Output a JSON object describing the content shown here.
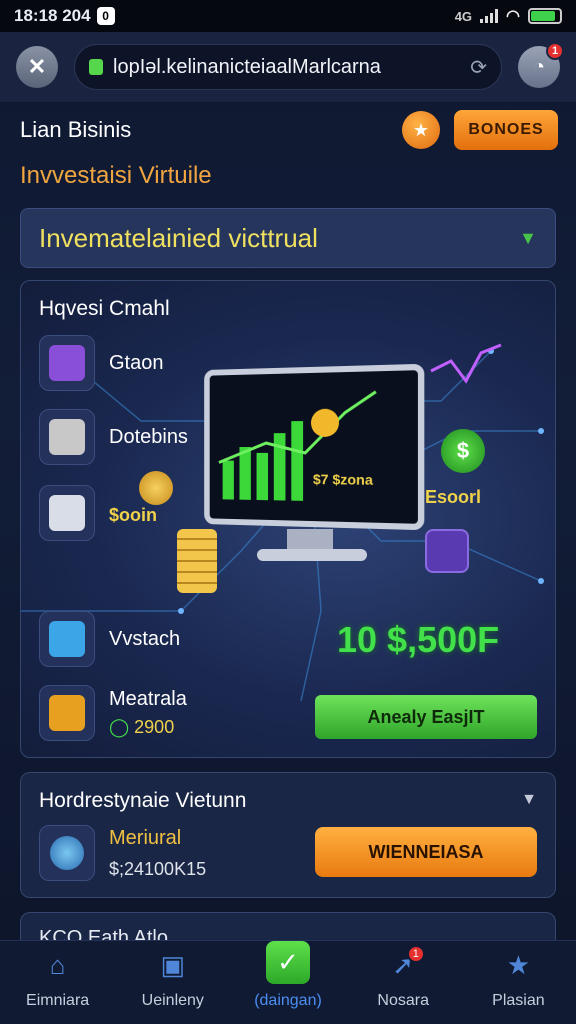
{
  "status_bar": {
    "time": "18:18 204",
    "notif_label": "0",
    "network": "4G"
  },
  "browser": {
    "url": "lopIəl.kelinanicteiaalMarlcarna",
    "badge": "1"
  },
  "header": {
    "title": "Lian Bisinis",
    "bonus_label": "BONOES"
  },
  "section_title": "Invvestaisi Virtuile",
  "dropdown": {
    "value": "Invematelainied victtrual"
  },
  "main_card": {
    "title": "Hqvesi Cmahl",
    "items": [
      {
        "label": "Gtaon",
        "color": "#8a4fd8"
      },
      {
        "label": "Dotebins",
        "color": "#c8c8c8"
      },
      {
        "label": "",
        "color": "#d8dde8"
      },
      {
        "label": "Vvstach",
        "color": "#3aa6e8"
      },
      {
        "label": "Meatrala",
        "sub": "2900",
        "color": "#e8a020"
      }
    ],
    "coin_price": "$ooin",
    "screen_price": "$7 $zona",
    "side_label": "Esoorl",
    "big_value": "10 $,500F",
    "apply_button": "Anealy EasjIT"
  },
  "second_card": {
    "title": "Hordrestynaie Vietunn",
    "item_name": "Meriural",
    "item_meta": "$;24100K15",
    "order_button": "WIENNEIASA"
  },
  "third_card": {
    "title": "KCO Eath Atlo"
  },
  "nav": [
    {
      "label": "Eimniara",
      "icon": "home-icon"
    },
    {
      "label": "Ueinleny",
      "icon": "wallet-icon"
    },
    {
      "label": "(daingan)",
      "icon": "check-icon"
    },
    {
      "label": "Nosara",
      "icon": "rocket-icon",
      "badge": "1"
    },
    {
      "label": "Plasian",
      "icon": "star-icon"
    }
  ],
  "colors": {
    "accent_orange": "#f0a640",
    "accent_green": "#42e04a",
    "background": "#0c1428"
  }
}
